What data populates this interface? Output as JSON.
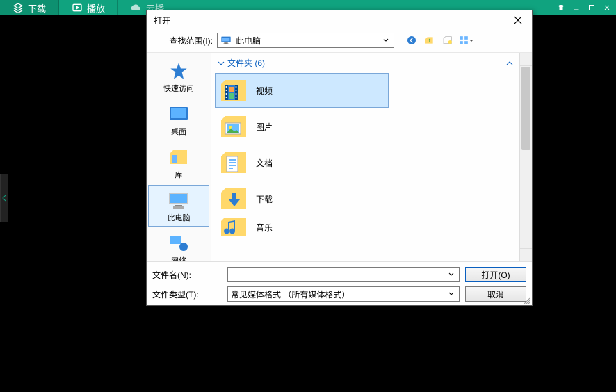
{
  "app": {
    "tabs": [
      {
        "icon": "download-icon",
        "label": "下载"
      },
      {
        "icon": "play-circle-icon",
        "label": "播放"
      },
      {
        "icon": "cloud-icon",
        "label": "云播"
      }
    ]
  },
  "dialog": {
    "title": "打开",
    "lookin_label": "查找范围(I):",
    "lookin_value": "此电脑",
    "places": [
      {
        "id": "quick",
        "label": "快速访问"
      },
      {
        "id": "desktop",
        "label": "桌面"
      },
      {
        "id": "lib",
        "label": "库"
      },
      {
        "id": "thispc",
        "label": "此电脑"
      },
      {
        "id": "network",
        "label": "网络"
      }
    ],
    "group_header": "文件夹 (6)",
    "folders": [
      {
        "kind": "video",
        "name": "视频",
        "selected": true
      },
      {
        "kind": "picture",
        "name": "图片",
        "selected": false
      },
      {
        "kind": "doc",
        "name": "文档",
        "selected": false
      },
      {
        "kind": "download",
        "name": "下载",
        "selected": false
      },
      {
        "kind": "music",
        "name": "音乐",
        "selected": false
      }
    ],
    "filename_label": "文件名(N):",
    "filename_value": "",
    "filetype_label": "文件类型(T):",
    "filetype_value": "常见媒体格式 （所有媒体格式）",
    "open_button": "打开(O)",
    "cancel_button": "取消"
  }
}
